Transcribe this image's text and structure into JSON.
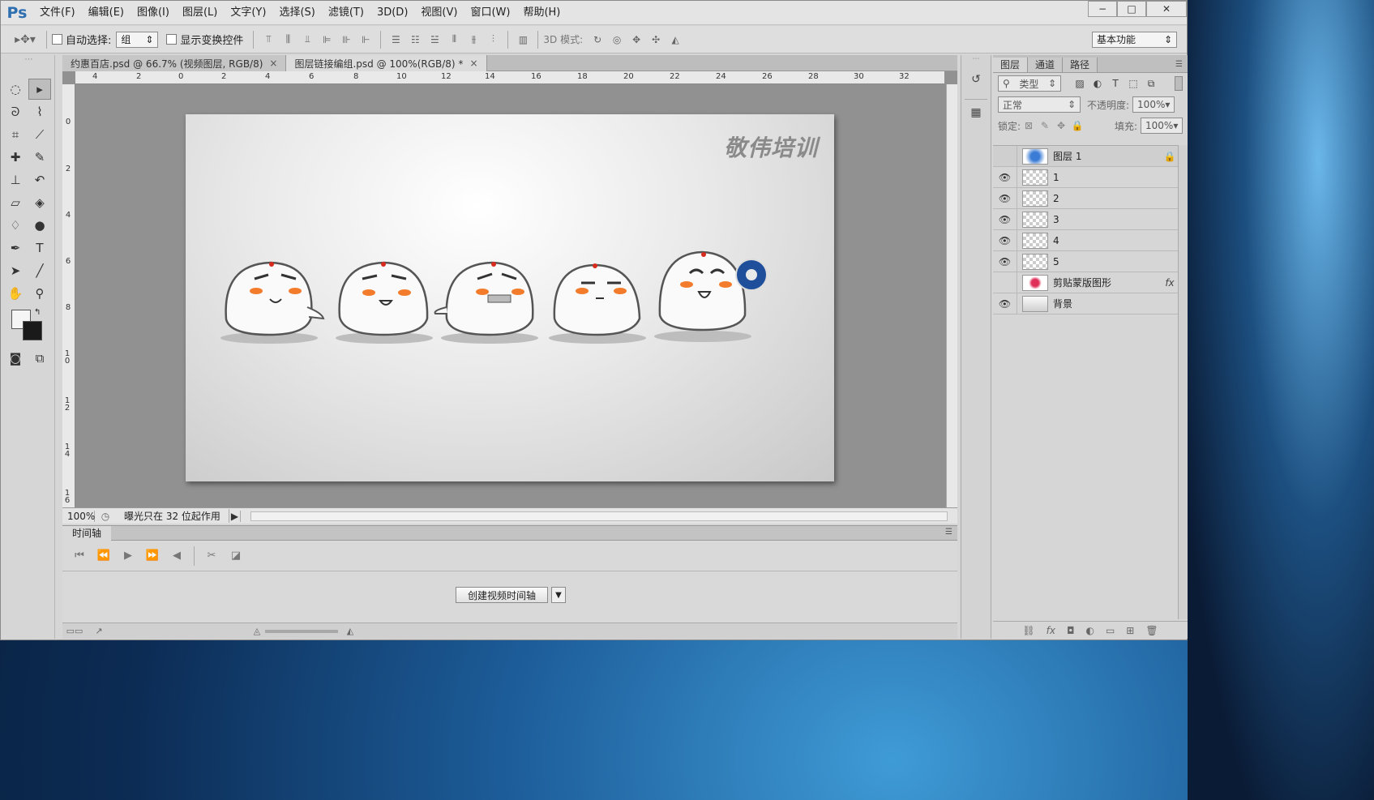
{
  "app": {
    "logo": "Ps",
    "menu": [
      "文件(F)",
      "编辑(E)",
      "图像(I)",
      "图层(L)",
      "文字(Y)",
      "选择(S)",
      "滤镜(T)",
      "3D(D)",
      "视图(V)",
      "窗口(W)",
      "帮助(H)"
    ],
    "window_controls": [
      "−",
      "□",
      "✕"
    ]
  },
  "options": {
    "auto_select_label": "自动选择:",
    "auto_select_value": "组",
    "show_transform_label": "显示变换控件",
    "mode3d_label": "3D 模式:",
    "workspace": "基本功能"
  },
  "tabs": [
    {
      "label": "约惠百店.psd @ 66.7% (视频图层, RGB/8)",
      "close": "×"
    },
    {
      "label": "图层链接编组.psd @ 100%(RGB/8) *",
      "close": "×"
    }
  ],
  "ruler_h": [
    "4",
    "2",
    "0",
    "2",
    "4",
    "6",
    "8",
    "10",
    "12",
    "14",
    "16",
    "18",
    "20",
    "22",
    "24",
    "26",
    "28",
    "30",
    "32"
  ],
  "ruler_v": [
    "0",
    "2",
    "4",
    "6",
    "8",
    "1 0",
    "1 2",
    "1 4",
    "1 6"
  ],
  "canvas": {
    "brand": "敬伟培训"
  },
  "status": {
    "zoom": "100%",
    "message": "曝光只在 32 位起作用"
  },
  "timeline": {
    "tab": "时间轴",
    "create_button": "创建视频时间轴"
  },
  "panel": {
    "tabs": [
      "图层",
      "通道",
      "路径"
    ],
    "filter_type": "类型",
    "blend_mode": "正常",
    "opacity_label": "不透明度:",
    "opacity_value": "100%",
    "lock_label": "锁定:",
    "fill_label": "填充:",
    "fill_value": "100%"
  },
  "layers": [
    {
      "name": "图层 1",
      "visible": false,
      "ext": "🔒"
    },
    {
      "name": "1",
      "visible": true,
      "ext": ""
    },
    {
      "name": "2",
      "visible": true,
      "ext": ""
    },
    {
      "name": "3",
      "visible": true,
      "ext": ""
    },
    {
      "name": "4",
      "visible": true,
      "ext": ""
    },
    {
      "name": "5",
      "visible": true,
      "ext": ""
    },
    {
      "name": "剪贴蒙版图形",
      "visible": false,
      "ext": "fx"
    },
    {
      "name": "背景",
      "visible": true,
      "ext": ""
    }
  ]
}
